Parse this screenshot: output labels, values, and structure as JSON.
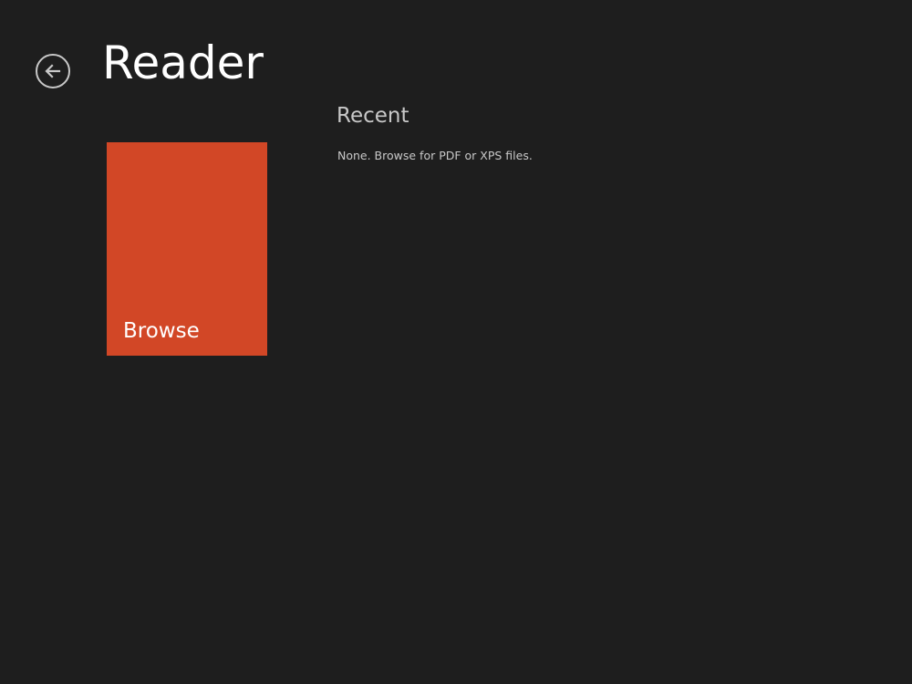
{
  "app": {
    "title": "Reader"
  },
  "header": {
    "back_icon": "back-arrow-circle-icon"
  },
  "tiles": {
    "browse_label": "Browse",
    "browse_color": "#d24726"
  },
  "recent": {
    "heading": "Recent",
    "empty_message": "None. Browse for PDF or XPS files."
  },
  "colors": {
    "background": "#1e1e1e",
    "accent": "#d24726",
    "text_primary": "#ffffff",
    "text_secondary": "#c8c8c8"
  }
}
